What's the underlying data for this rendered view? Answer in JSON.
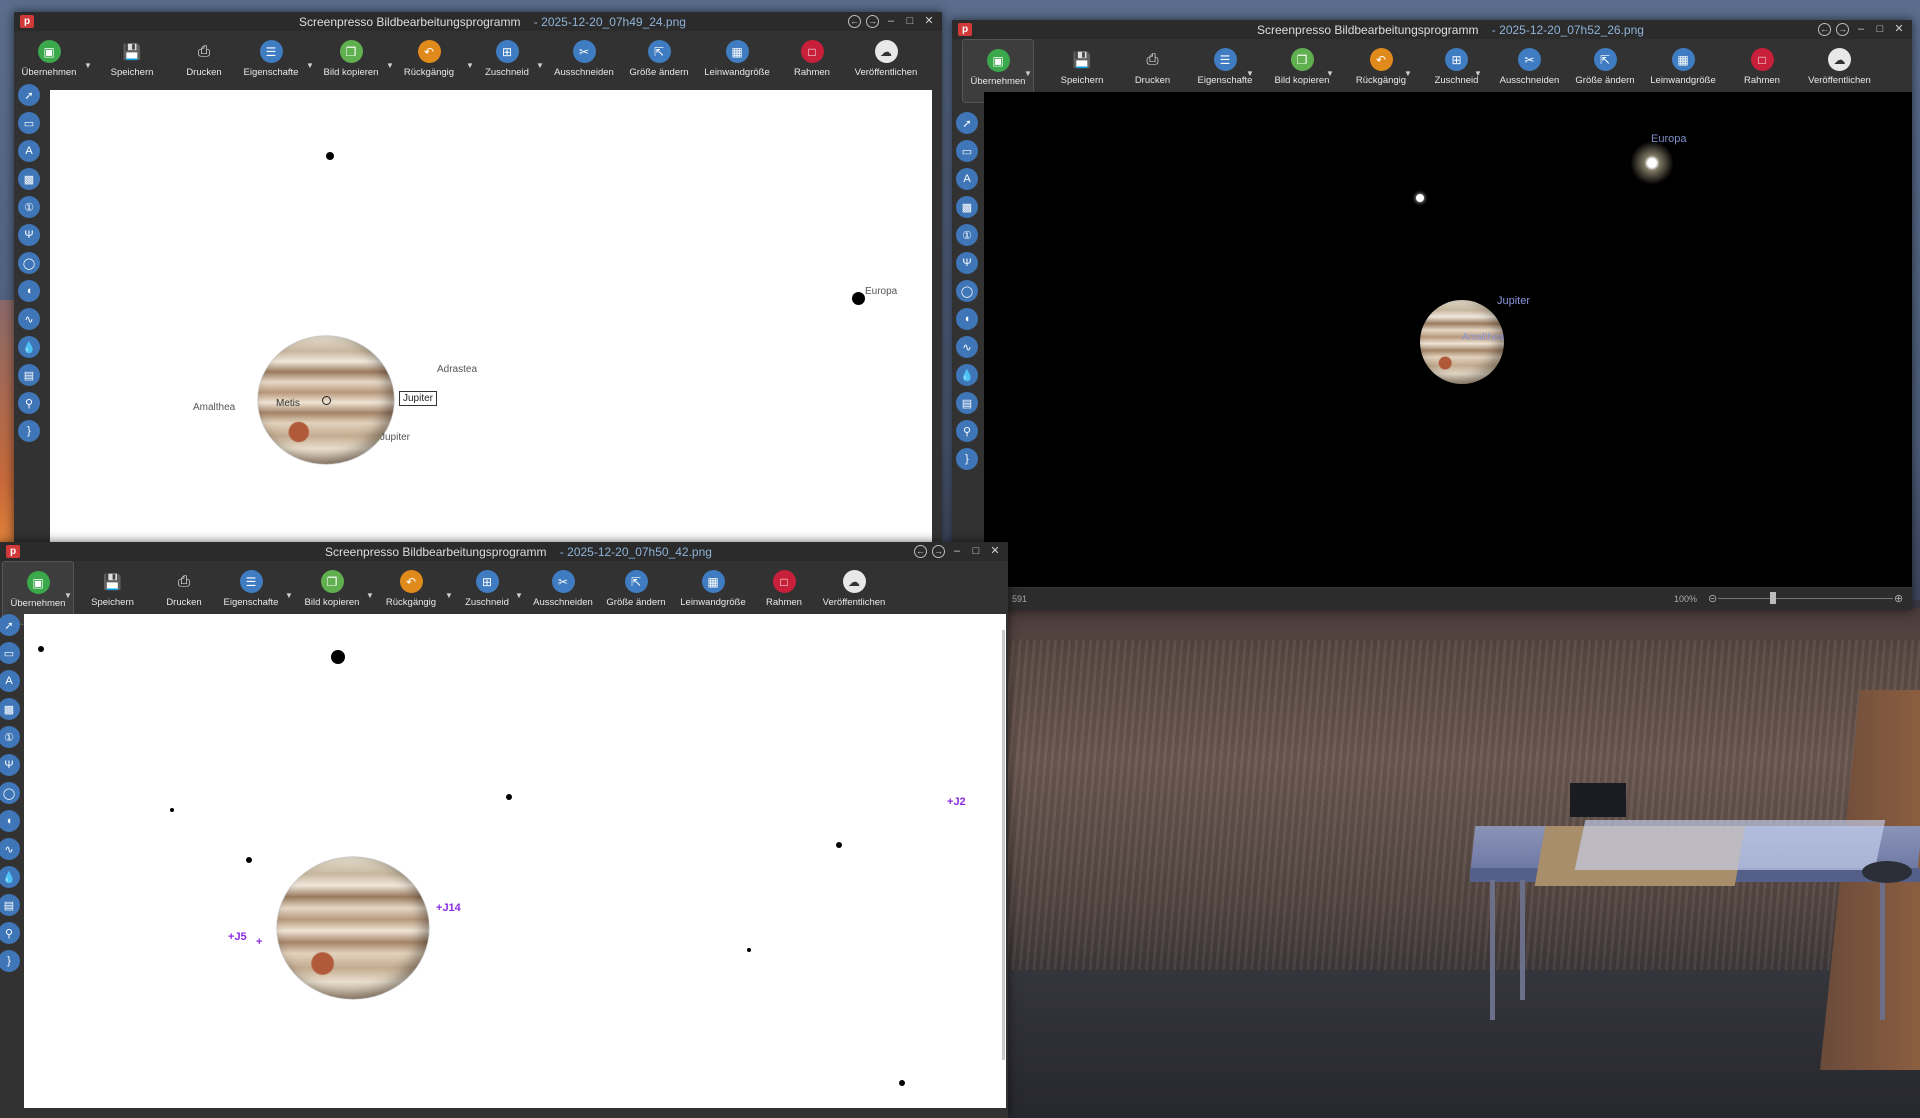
{
  "app_name": "Screenpresso  Bildbearbeitungsprogramm",
  "windows": {
    "w1": {
      "file": "2025-12-20_07h49_24.png"
    },
    "w2": {
      "file": "2025-12-20_07h52_26.png",
      "status_left": "591",
      "zoom": "100%"
    },
    "w3": {
      "file": "2025-12-20_07h50_42.png"
    }
  },
  "toolbar": {
    "accept": "Übernehmen",
    "save": "Speichern",
    "print": "Drucken",
    "properties": "Eigenschafte",
    "copy_image": "Bild kopieren",
    "undo": "Rückgängig",
    "crop": "Zuschneid",
    "cut": "Ausschneiden",
    "resize": "Größe ändern",
    "canvas_size": "Leinwandgröße",
    "frame": "Rahmen",
    "publish": "Veröffentlichen"
  },
  "w1_labels": {
    "europa": "Europa",
    "adrastea": "Adrastea",
    "amalthea": "Amalthea",
    "metis": "Metis",
    "jupiter_box": "Jupiter",
    "jupiter": "Jupiter"
  },
  "w2_labels": {
    "europa": "Europa",
    "jupiter": "Jupiter",
    "amalthea": "Amalthea"
  },
  "w3_labels": {
    "j2": "J2",
    "j14": "J14",
    "j5": "J5"
  }
}
